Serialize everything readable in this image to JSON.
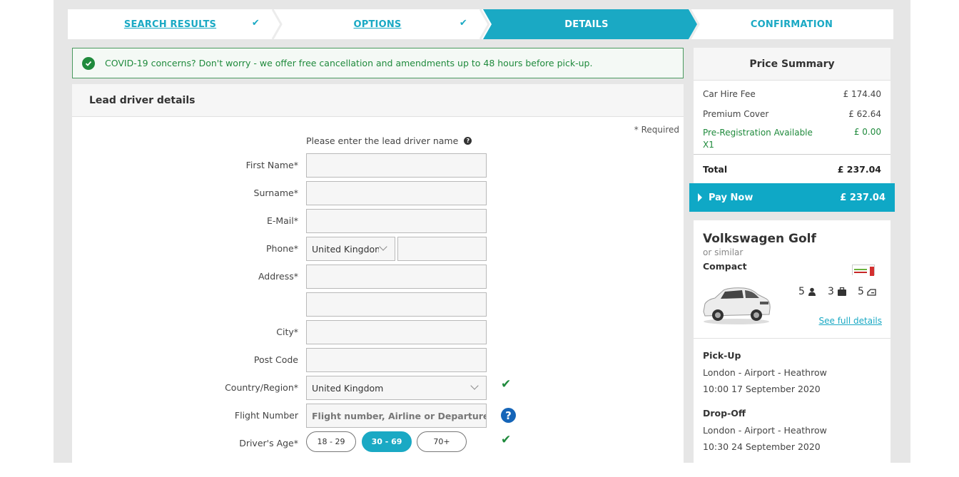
{
  "steps": [
    {
      "label": "SEARCH RESULTS",
      "state": "done"
    },
    {
      "label": "OPTIONS",
      "state": "done"
    },
    {
      "label": "DETAILS",
      "state": "active"
    },
    {
      "label": "CONFIRMATION",
      "state": "pending"
    }
  ],
  "colors": {
    "accent": "#1aa9c4",
    "success": "#1f8a3c",
    "help": "#1565b8"
  },
  "covid_banner": "COVID-19 concerns? Don't worry - we offer free cancellation and amendments up to 48 hours before pick-up.",
  "form": {
    "title": "Lead driver details",
    "required_note": "* Required",
    "prompt": "Please enter the lead driver name",
    "labels": {
      "first_name": "First Name*",
      "surname": "Surname*",
      "email": "E-Mail*",
      "phone": "Phone*",
      "address": "Address*",
      "city": "City*",
      "post_code": "Post Code",
      "country": "Country/Region*",
      "flight": "Flight Number",
      "age": "Driver's Age*"
    },
    "values": {
      "phone_country": "United Kingdom",
      "country": "United Kingdom"
    },
    "placeholders": {
      "flight": "Flight number, Airline or Departure airport"
    },
    "age_options": [
      "18 - 29",
      "30 - 69",
      "70+"
    ],
    "age_selected": "30 - 69"
  },
  "price_summary": {
    "title": "Price Summary",
    "items": [
      {
        "label": "Car Hire Fee",
        "value": "£ 174.40"
      },
      {
        "label": "Premium Cover",
        "value": "£ 62.64"
      },
      {
        "label": "Pre-Registration Available X1",
        "value": "£ 0.00"
      }
    ],
    "total_label": "Total",
    "total_value": "£ 237.04",
    "pay_label": "Pay Now",
    "pay_value": "£ 237.04"
  },
  "car": {
    "name": "Volkswagen Golf",
    "similar": "or similar",
    "category": "Compact",
    "seats": "5",
    "bags": "3",
    "doors": "5",
    "details_link": "See full details",
    "pickup_label": "Pick-Up",
    "pickup_location": "London - Airport - Heathrow",
    "pickup_time": "10:00 17 September 2020",
    "dropoff_label": "Drop-Off",
    "dropoff_location": "London - Airport - Heathrow",
    "dropoff_time": "10:30 24 September 2020"
  }
}
